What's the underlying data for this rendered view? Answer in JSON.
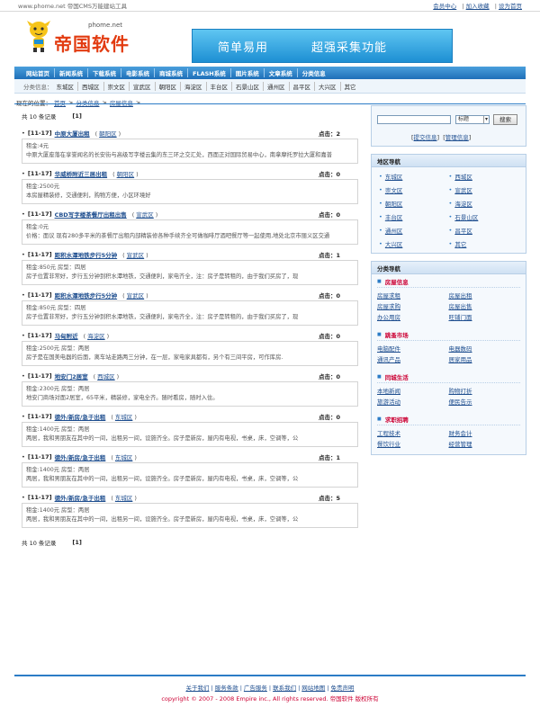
{
  "topbar": {
    "left": "www.phome.net 帝国CMS万能建站工具",
    "links": [
      "会员中心",
      "加入收藏",
      "设为首页"
    ]
  },
  "logo": {
    "url": "phome.net",
    "name": "帝国软件"
  },
  "banner": {
    "text1": "简单易用",
    "text2": "超强采集功能"
  },
  "nav": [
    "网站首页",
    "新闻系统",
    "下载系统",
    "电影系统",
    "商城系统",
    "FLASH系统",
    "图片系统",
    "文章系统",
    "分类信息"
  ],
  "subnav": {
    "label": "分类信息：",
    "items": [
      "东城区",
      "西城区",
      "崇文区",
      "宣武区",
      "朝阳区",
      "海淀区",
      "丰台区",
      "石景山区",
      "通州区",
      "昌平区",
      "大兴区",
      "其它"
    ]
  },
  "breadcrumb": {
    "label": "现在的位置：",
    "items": [
      "首页",
      "分类信息",
      "房屋信息"
    ],
    "sep": ">"
  },
  "count_text": "共 10 条记录",
  "page_text": "[1]",
  "listings": [
    {
      "date": "[11-17]",
      "title": "中原大厦出租",
      "area": "朝阳区",
      "clicks": "点击：2",
      "body": "租金:4元\n中原大厦座落在享誉闻名的长安街与高级写字楼云集的东三环之交汇处，西面正对国际贸易中心，南拿摩托罗拉大厦和嘉普"
    },
    {
      "date": "[11-17]",
      "title": "华威桥附近三居出租",
      "area": "朝阳区",
      "clicks": "点击：0",
      "body": "租金:2500元\n本房屋精装修，交通便利，购物方便，小区环境好"
    },
    {
      "date": "[11-17]",
      "title": "CBD写字楼茶餐厅出租出售",
      "area": "宣武区",
      "clicks": "点击：0",
      "body": "租金:0元\n价格：面议 现有280多平米的茶餐厅出租内部精装修各种手续齐全可做咖啡厅酒吧餐厅等一起使用,地处北京市丽义区交通"
    },
    {
      "date": "[11-17]",
      "title": "距积水潭地铁步行5分钟",
      "area": "宣武区",
      "clicks": "点击：1",
      "body": "租金:850元 房型：四居\n房子位置非常好，步行五分钟到积水潭地铁，交通便利，家电齐全，注：房子是转租的，由于我们买房了，现"
    },
    {
      "date": "[11-17]",
      "title": "距积水潭地铁步行5分钟",
      "area": "宣武区",
      "clicks": "点击：0",
      "body": "租金:850元 房型：四居\n房子位置非常好，步行五分钟到积水潭地铁，交通便利，家电齐全，注：房子是转租的，由于我们买房了，现"
    },
    {
      "date": "[11-17]",
      "title": "马甸附近",
      "area": "海淀区",
      "clicks": "点击：0",
      "body": "租金:2500元 房型：两居\n房子是在国美电器的后面，离车站走路两三分钟，在一层，家电家具都有，另个有三间平房，可作库房."
    },
    {
      "date": "[11-17]",
      "title": "地安门2居室",
      "area": "西城区",
      "clicks": "点击：0",
      "body": "租金:2300元 房型：两居\n地安门商场对面2居室，65平米，精装修，家电全齐。随时看房，随时入住。"
    },
    {
      "date": "[11-17]",
      "title": "德外/新房/急于出租",
      "area": "东城区",
      "clicks": "点击：0",
      "body": "租金:1400元 房型：两居\n两居，我和男朋友在其中的一间，出租另一间，设施齐全。房子是新房，屋内有电视，书桌，床，空调等，公"
    },
    {
      "date": "[11-17]",
      "title": "德外/新房/急于出租",
      "area": "东城区",
      "clicks": "点击：1",
      "body": "租金:1400元 房型：两居\n两居，我和男朋友在其中的一间，出租另一间，设施齐全。房子是新房，屋内有电视，书桌，床，空调等，公"
    },
    {
      "date": "[11-17]",
      "title": "德外/新房/急于出租",
      "area": "东城区",
      "clicks": "点击：5",
      "body": "租金:1400元 房型：两居\n两居，我和男朋友在其中的一间，出租另一间，设施齐全。房子是新房，屋内有电视，书桌，床，空调等，公"
    }
  ],
  "search": {
    "select": "标题",
    "button": "搜索",
    "submit_link": "提交信息",
    "manage_link": "管理信息"
  },
  "area_nav": {
    "title": "地区导航",
    "items": [
      "东城区",
      "西城区",
      "崇文区",
      "宣武区",
      "朝阳区",
      "海淀区",
      "丰台区",
      "石景山区",
      "通州区",
      "昌平区",
      "大兴区",
      "其它"
    ]
  },
  "category_nav": {
    "title": "分类导航",
    "groups": [
      {
        "title": "房屋信息",
        "items": [
          "房屋求租",
          "房屋出租",
          "房屋求购",
          "房屋出售",
          "办公用房",
          "旺铺门面"
        ]
      },
      {
        "title": "跳蚤市场",
        "items": [
          "电脑配件",
          "电器数码",
          "通讯产品",
          "居家用品"
        ]
      },
      {
        "title": "同城生活",
        "items": [
          "本地新闻",
          "购物打折",
          "旅游活动",
          "便民告示"
        ]
      },
      {
        "title": "求职招聘",
        "items": [
          "工程技术",
          "财务会计",
          "餐饮行业",
          "经营管理"
        ]
      }
    ]
  },
  "footer": {
    "links": [
      "关于我们",
      "服务条款",
      "广告服务",
      "联系我们",
      "网站地图",
      "免责声明"
    ],
    "copyright": "copyright © 2007 - 2008 Empire inc., All rights reserved.  帝国软件 版权所有"
  },
  "colors": {
    "accent": "#2c7cc6",
    "link": "#1e4e8f",
    "logo": "#e23b10"
  }
}
